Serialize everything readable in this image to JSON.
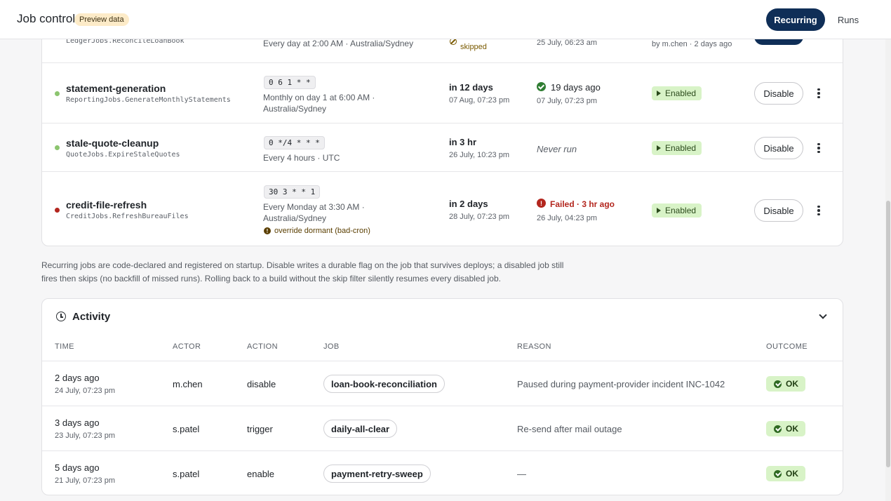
{
  "header": {
    "title": "Job control",
    "badge": "Preview data",
    "tabs": [
      {
        "label": "Recurring",
        "active": true
      },
      {
        "label": "Runs",
        "active": false
      }
    ]
  },
  "jobs": {
    "partial_row": {
      "class": "LedgerJobs.ReconcileLoanBook",
      "schedule": "Every day at 2:00 AM · Australia/Sydney",
      "last_status": "skipped",
      "last_abs": "25 July, 06:23 am",
      "state_note": "by m.chen · 2 days ago"
    },
    "rows": [
      {
        "name": "statement-generation",
        "class": "ReportingJobs.GenerateMonthlyStatements",
        "cron": "0 6 1 * *",
        "schedule_line1": "Monthly on day 1 at 6:00 AM ·",
        "schedule_line2": "Australia/Sydney",
        "next_rel": "in 12 days",
        "next_abs": "07 Aug, 07:23 pm",
        "last_text": "19 days ago",
        "last_abs": "07 July, 07:23 pm",
        "state": "Enabled",
        "action": "Disable"
      },
      {
        "name": "stale-quote-cleanup",
        "class": "QuoteJobs.ExpireStaleQuotes",
        "cron": "0 */4 * * *",
        "schedule_line1": "Every 4 hours · UTC",
        "next_rel": "in 3 hr",
        "next_abs": "26 July, 10:23 pm",
        "last_text": "Never run",
        "state": "Enabled",
        "action": "Disable"
      },
      {
        "name": "credit-file-refresh",
        "class": "CreditJobs.RefreshBureauFiles",
        "cron": "30 3 * * 1",
        "schedule_line1": "Every Monday at 3:30 AM ·",
        "schedule_line2": "Australia/Sydney",
        "warning": "override dormant (bad-cron)",
        "next_rel": "in 2 days",
        "next_abs": "28 July, 07:23 pm",
        "last_text": "Failed · 3 hr ago",
        "last_abs": "26 July, 04:23 pm",
        "state": "Enabled",
        "action": "Disable"
      }
    ]
  },
  "footnote": {
    "line1": "Recurring jobs are code-declared and registered on startup. Disable writes a durable flag on the job that survives deploys; a disabled job still",
    "line2": "fires then skips (no backfill of missed runs). Rolling back to a build without the skip filter silently resumes every disabled job."
  },
  "activity": {
    "title": "Activity",
    "columns": [
      "TIME",
      "ACTOR",
      "ACTION",
      "JOB",
      "REASON",
      "OUTCOME"
    ],
    "rows": [
      {
        "rel": "2 days ago",
        "abs": "24 July, 07:23 pm",
        "actor": "m.chen",
        "action": "disable",
        "job": "loan-book-reconciliation",
        "reason": "Paused during payment-provider incident INC-1042",
        "outcome": "OK"
      },
      {
        "rel": "3 days ago",
        "abs": "23 July, 07:23 pm",
        "actor": "s.patel",
        "action": "trigger",
        "job": "daily-all-clear",
        "reason": "Re-send after mail outage",
        "outcome": "OK"
      },
      {
        "rel": "5 days ago",
        "abs": "21 July, 07:23 pm",
        "actor": "s.patel",
        "action": "enable",
        "job": "payment-retry-sweep",
        "reason": "—",
        "outcome": "OK"
      }
    ]
  },
  "colors": {
    "primary": "#0f2e57",
    "enabled_bg": "#d8f3c7",
    "failed": "#b3261e",
    "ok_green": "#2f7d32",
    "badge_bg": "#fdebc8"
  }
}
